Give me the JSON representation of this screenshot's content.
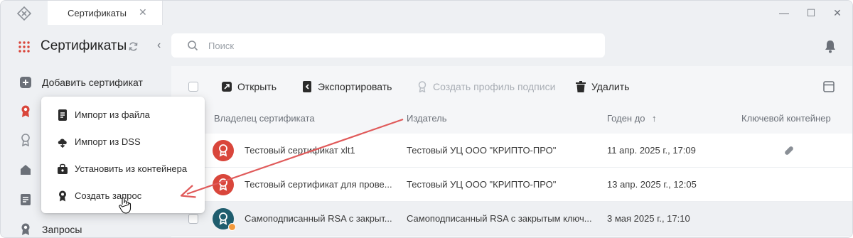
{
  "window": {
    "tab_title": "Сертификаты",
    "tab_close": "✕",
    "minimize": "—",
    "maximize": "☐",
    "close": "✕"
  },
  "sidebar": {
    "title": "Сертификаты",
    "collapse": "‹",
    "add_label": "Добавить сертификат",
    "bottom_label": "Запросы"
  },
  "search": {
    "placeholder": "Поиск"
  },
  "toolbar": {
    "open": "Открыть",
    "export": "Экспортировать",
    "create_profile": "Создать профиль подписи",
    "delete": "Удалить"
  },
  "table": {
    "columns": [
      "Владелец сертификата",
      "Издатель",
      "Годен до",
      "Ключевой контейнер"
    ],
    "sort_arrow": "↑",
    "rows": [
      {
        "owner": "Тестовый сертификат xlt1",
        "issuer": "Тестовый УЦ ООО \"КРИПТО-ПРО\"",
        "valid_until": "11 апр. 2025 г., 17:09"
      },
      {
        "owner": "Тестовый сертификат для прове...",
        "issuer": "Тестовый УЦ ООО \"КРИПТО-ПРО\"",
        "valid_until": "13 апр. 2025 г., 12:05"
      },
      {
        "owner": "Самоподписанный RSA с закрыт...",
        "issuer": "Самоподписанный RSA с закрытым ключ...",
        "valid_until": "3 мая 2025 г., 17:10"
      }
    ]
  },
  "menu": {
    "items": [
      {
        "label": "Импорт из файла",
        "icon": "file-icon"
      },
      {
        "label": "Импорт из DSS",
        "icon": "cloud-download-icon"
      },
      {
        "label": "Установить из контейнера",
        "icon": "container-icon"
      },
      {
        "label": "Создать запрос",
        "icon": "certificate-request-icon"
      }
    ]
  },
  "colors": {
    "accent_red": "#d9463b",
    "teal": "#1f5d6e",
    "annotation_arrow": "#e05a5a"
  }
}
